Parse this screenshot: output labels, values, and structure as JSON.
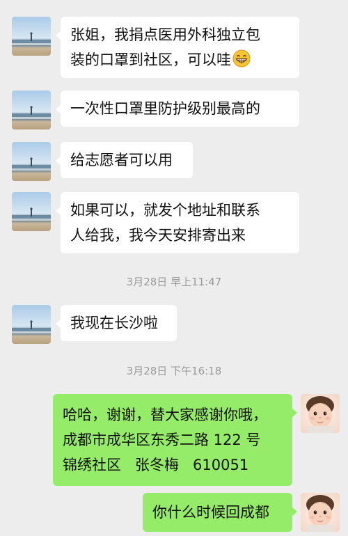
{
  "messages": [
    {
      "sender": "other",
      "lines": [
        "张姐，我捐点医用外科独立包",
        "装的口罩到社区，可以哇"
      ],
      "emoji": "grinning-face-emoji"
    },
    {
      "sender": "other",
      "lines": [
        "一次性口罩里防护级别最高的"
      ]
    },
    {
      "sender": "other",
      "lines": [
        "给志愿者可以用"
      ]
    },
    {
      "sender": "other",
      "lines": [
        "如果可以，就发个地址和联系",
        "人给我，我今天安排寄出来"
      ]
    },
    {
      "type": "timestamp",
      "text": "3月28日 早上11:47"
    },
    {
      "sender": "other",
      "lines": [
        "我现在长沙啦"
      ]
    },
    {
      "type": "timestamp",
      "text": "3月28日 下午16:18"
    },
    {
      "sender": "me",
      "lines": [
        "哈哈，谢谢，替大家感谢你哦，",
        "成都市成华区东秀二路 122 号",
        "锦绣社区   张冬梅   610051"
      ]
    },
    {
      "sender": "me",
      "lines": [
        "你什么时候回成都"
      ]
    }
  ],
  "colors": {
    "background": "#ededed",
    "incoming_bubble": "#ffffff",
    "outgoing_bubble": "#95ec69",
    "timestamp_text": "#9a9a9a"
  },
  "icons": {
    "other_avatar": "beach-landscape-avatar",
    "my_avatar": "baby-photo-avatar"
  }
}
